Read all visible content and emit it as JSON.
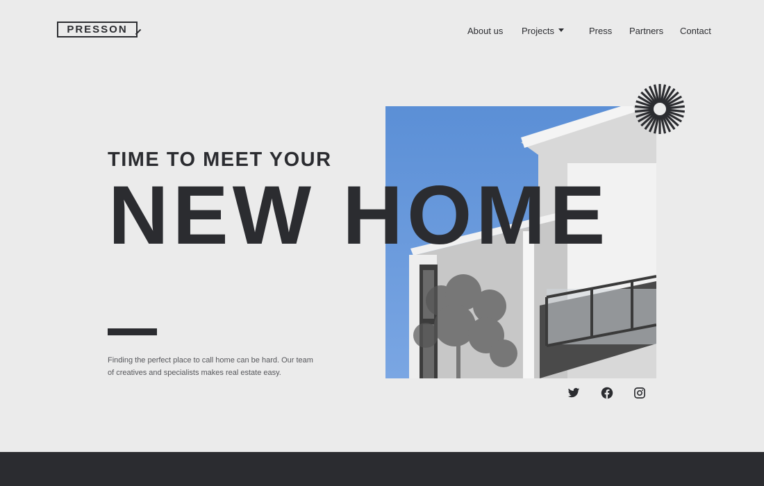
{
  "brand": {
    "logo_text": "PRESSON"
  },
  "nav": {
    "items": [
      {
        "label": "About us"
      },
      {
        "label": "Projects"
      },
      {
        "label": "Press"
      },
      {
        "label": "Partners"
      },
      {
        "label": "Contact"
      }
    ]
  },
  "hero": {
    "kicker": "TIME TO MEET YOUR",
    "headline": "NEW HOME",
    "body": "Finding the perfect place to call home can be hard. Our team of creatives and specialists makes real estate easy."
  },
  "social": {
    "icons": [
      "twitter-icon",
      "facebook-icon",
      "instagram-icon"
    ]
  },
  "colors": {
    "background": "#ebebeb",
    "ink": "#2b2c30",
    "sky": "#5b8fd6"
  }
}
